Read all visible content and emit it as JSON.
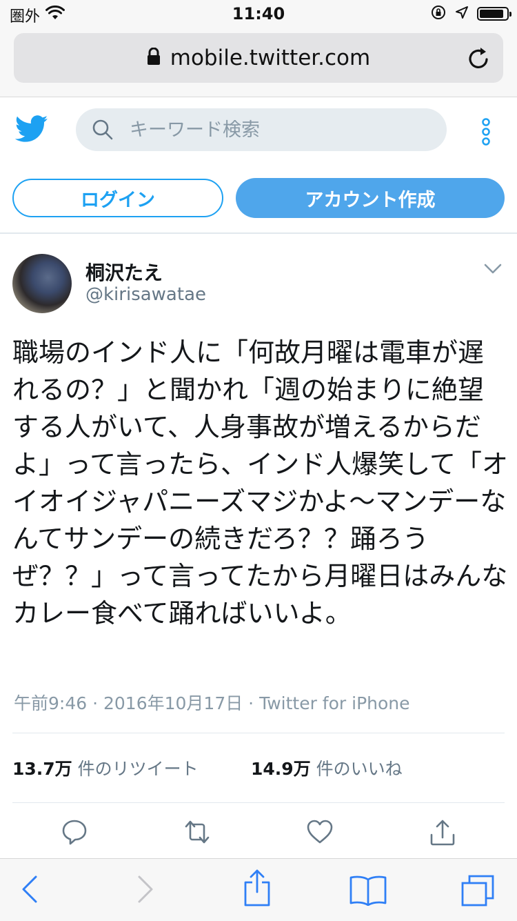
{
  "status_bar": {
    "carrier": "圏外",
    "time": "11:40",
    "battery_level": 0.9
  },
  "browser": {
    "url": "mobile.twitter.com"
  },
  "header": {
    "search_placeholder": "キーワード検索",
    "login_label": "ログイン",
    "signup_label": "アカウント作成",
    "brand_color": "#1da1f2"
  },
  "tweet": {
    "display_name": "桐沢たえ",
    "username": "@kirisawatae",
    "text": "職場のインド人に「何故月曜は電車が遅れるの？」と聞かれ「週の始まりに絶望する人がいて、人身事故が増えるからだよ」って言ったら、インド人爆笑して「オイオイジャパニーズマジかよ～マンデーなんてサンデーの続きだろ？？踊ろうぜ？？」って言ってたから月曜日はみんなカレー食べて踊ればいいよ。",
    "meta": "午前9:46 · 2016年10月17日 · Twitter for iPhone",
    "retweets_count": "13.7万",
    "retweets_label": "件のリツイート",
    "likes_count": "14.9万",
    "likes_label": "件のいいね"
  },
  "icons": [
    "wifi-icon",
    "rotation-lock-icon",
    "location-icon",
    "battery-icon",
    "lock-icon",
    "reload-icon",
    "twitter-bird-icon",
    "search-icon",
    "more-icon",
    "chevron-down-icon",
    "reply-icon",
    "retweet-icon",
    "like-icon",
    "share-icon",
    "back-icon",
    "forward-icon",
    "safari-share-icon",
    "bookmarks-icon",
    "tabs-icon"
  ]
}
